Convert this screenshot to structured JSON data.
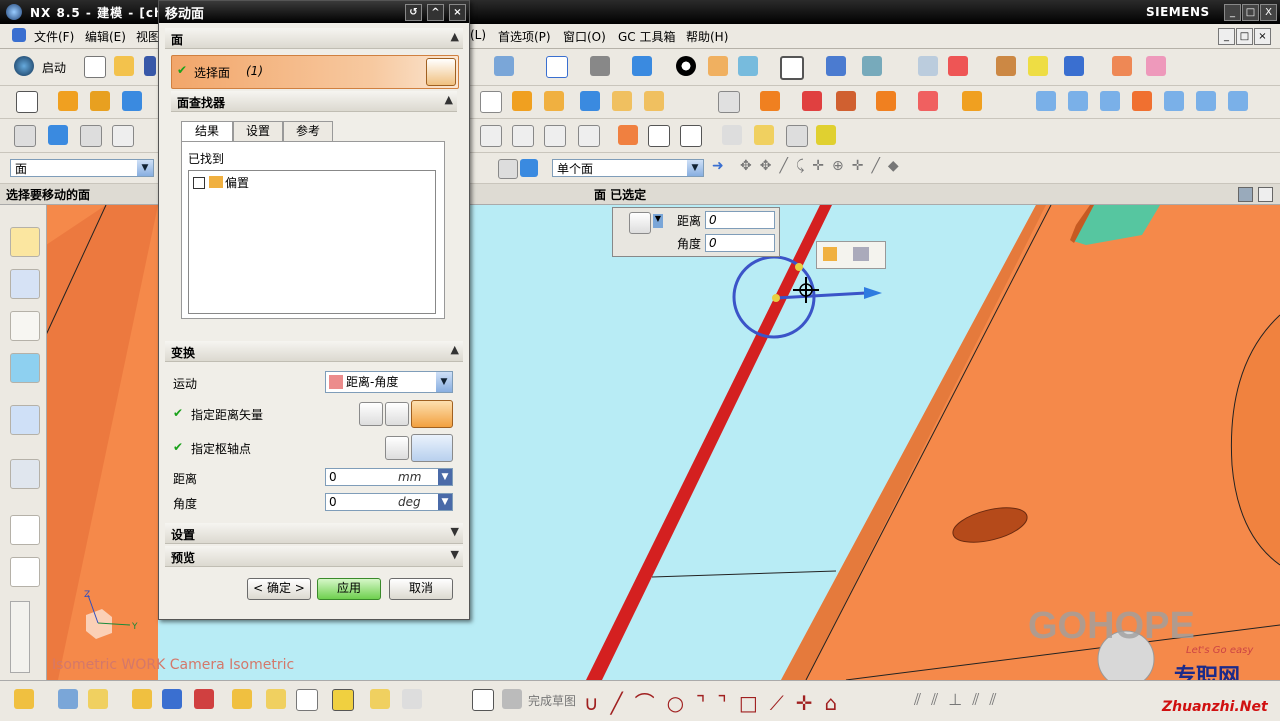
{
  "window": {
    "title": "NX 8.5 - 建模 - [ch",
    "brand": "SIEMENS",
    "controls": [
      "_",
      "□",
      "X"
    ]
  },
  "menubar": {
    "items_left": [
      "文件(F)",
      "编辑(E)",
      "视图"
    ],
    "items_right": [
      "(L)",
      "首选项(P)",
      "窗口(O)",
      "GC 工具箱",
      "帮助(H)"
    ]
  },
  "toolbar": {
    "start_label": "启动",
    "selection_filter": "面",
    "face_rule": "单个面",
    "finish_sketch": "完成草图"
  },
  "cue": {
    "prompt": "选择要移动的面",
    "status": "面 已选定"
  },
  "dialog": {
    "title": "移动面",
    "face_section": "面",
    "select_face_label": "选择面",
    "select_face_count": "(1)",
    "face_finder_section": "面查找器",
    "tabs": [
      "结果",
      "设置",
      "参考"
    ],
    "found_label": "已找到",
    "found_items": [
      "偏置"
    ],
    "transform_section": "变换",
    "motion_label": "运动",
    "motion_value": "距离-角度",
    "distance_vector_label": "指定距离矢量",
    "pivot_label": "指定枢轴点",
    "distance_label": "距离",
    "distance_value": "0",
    "distance_unit": "mm",
    "angle_label": "角度",
    "angle_value": "0",
    "angle_unit": "deg",
    "settings_section": "设置",
    "preview_section": "预览",
    "ok_label": "< 确定 >",
    "apply_label": "应用",
    "cancel_label": "取消"
  },
  "handle_panel": {
    "distance_label": "距离",
    "distance_value": "0",
    "angle_label": "角度",
    "angle_value": "0"
  },
  "viewport": {
    "view_label": "Isometric WORK Camera Isometric",
    "watermark": "GOHOPE",
    "site_cn": "专职网",
    "site_url": "Zhuanzhi.Net",
    "slogan": "Let's Go easy"
  },
  "colors": {
    "viewport_bg": "#b8ecf5",
    "part_orange": "#f5894a",
    "face_red": "#d42020",
    "dialog_header_orange": "#f2a66a",
    "apply_green": "#8fe07a",
    "check_green": "#1aa11a"
  },
  "icons": [
    "check-icon",
    "cube-icon",
    "vector-icon",
    "point-icon",
    "axis-triad-icon",
    "scroll-down-icon"
  ]
}
